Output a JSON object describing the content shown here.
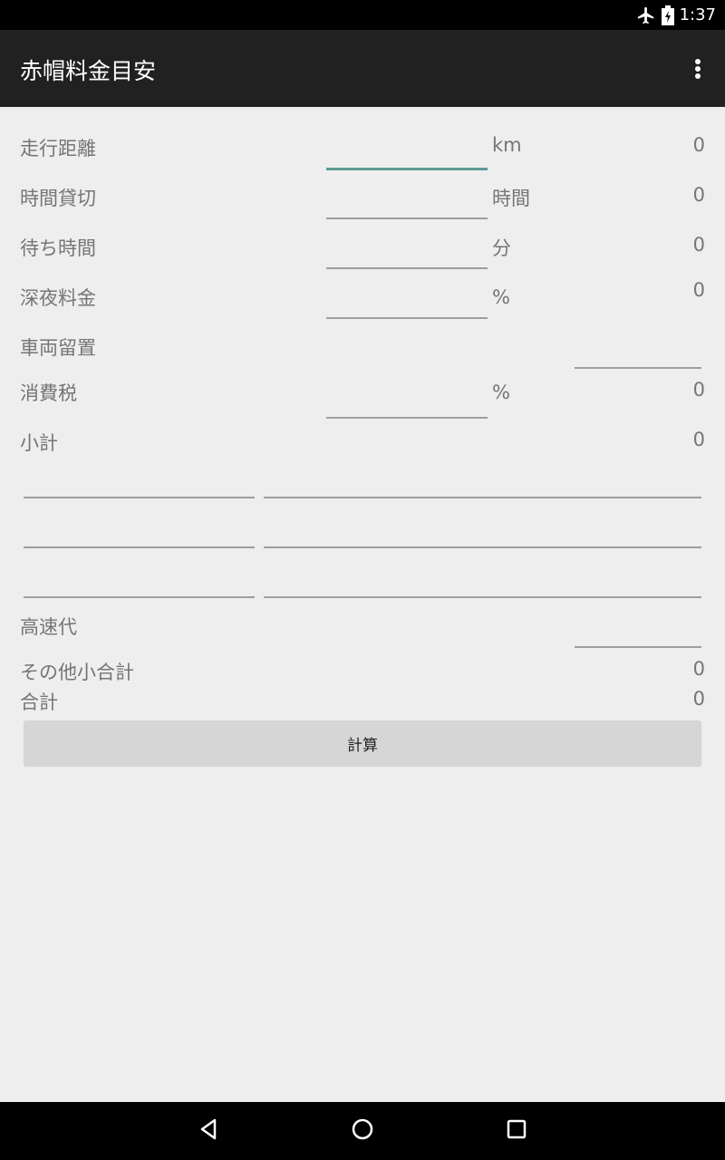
{
  "status_bar": {
    "time": "1:37",
    "icons": [
      "airplane-icon",
      "battery-icon"
    ]
  },
  "app_bar": {
    "title": "赤帽料金目安",
    "menu_icon": "overflow-menu-icon"
  },
  "form": {
    "rows": [
      {
        "label": "走行距離",
        "unit": "km",
        "value": "0"
      },
      {
        "label": "時間貸切",
        "unit": "時間",
        "value": "0"
      },
      {
        "label": "待ち時間",
        "unit": "分",
        "value": "0"
      },
      {
        "label": "深夜料金",
        "unit": "%",
        "value": "0"
      },
      {
        "label": "車両留置"
      },
      {
        "label": "消費税",
        "unit": "%",
        "value": "0"
      },
      {
        "label": "小計",
        "value": "0"
      },
      {
        "label": "高速代"
      },
      {
        "label": "その他小合計",
        "value": "0"
      },
      {
        "label": "合計",
        "value": "0"
      }
    ]
  },
  "calc_button": {
    "label": "計算"
  },
  "colors": {
    "accent": "#5e9c95",
    "app_bar": "#212121",
    "background": "#eeeeee"
  }
}
